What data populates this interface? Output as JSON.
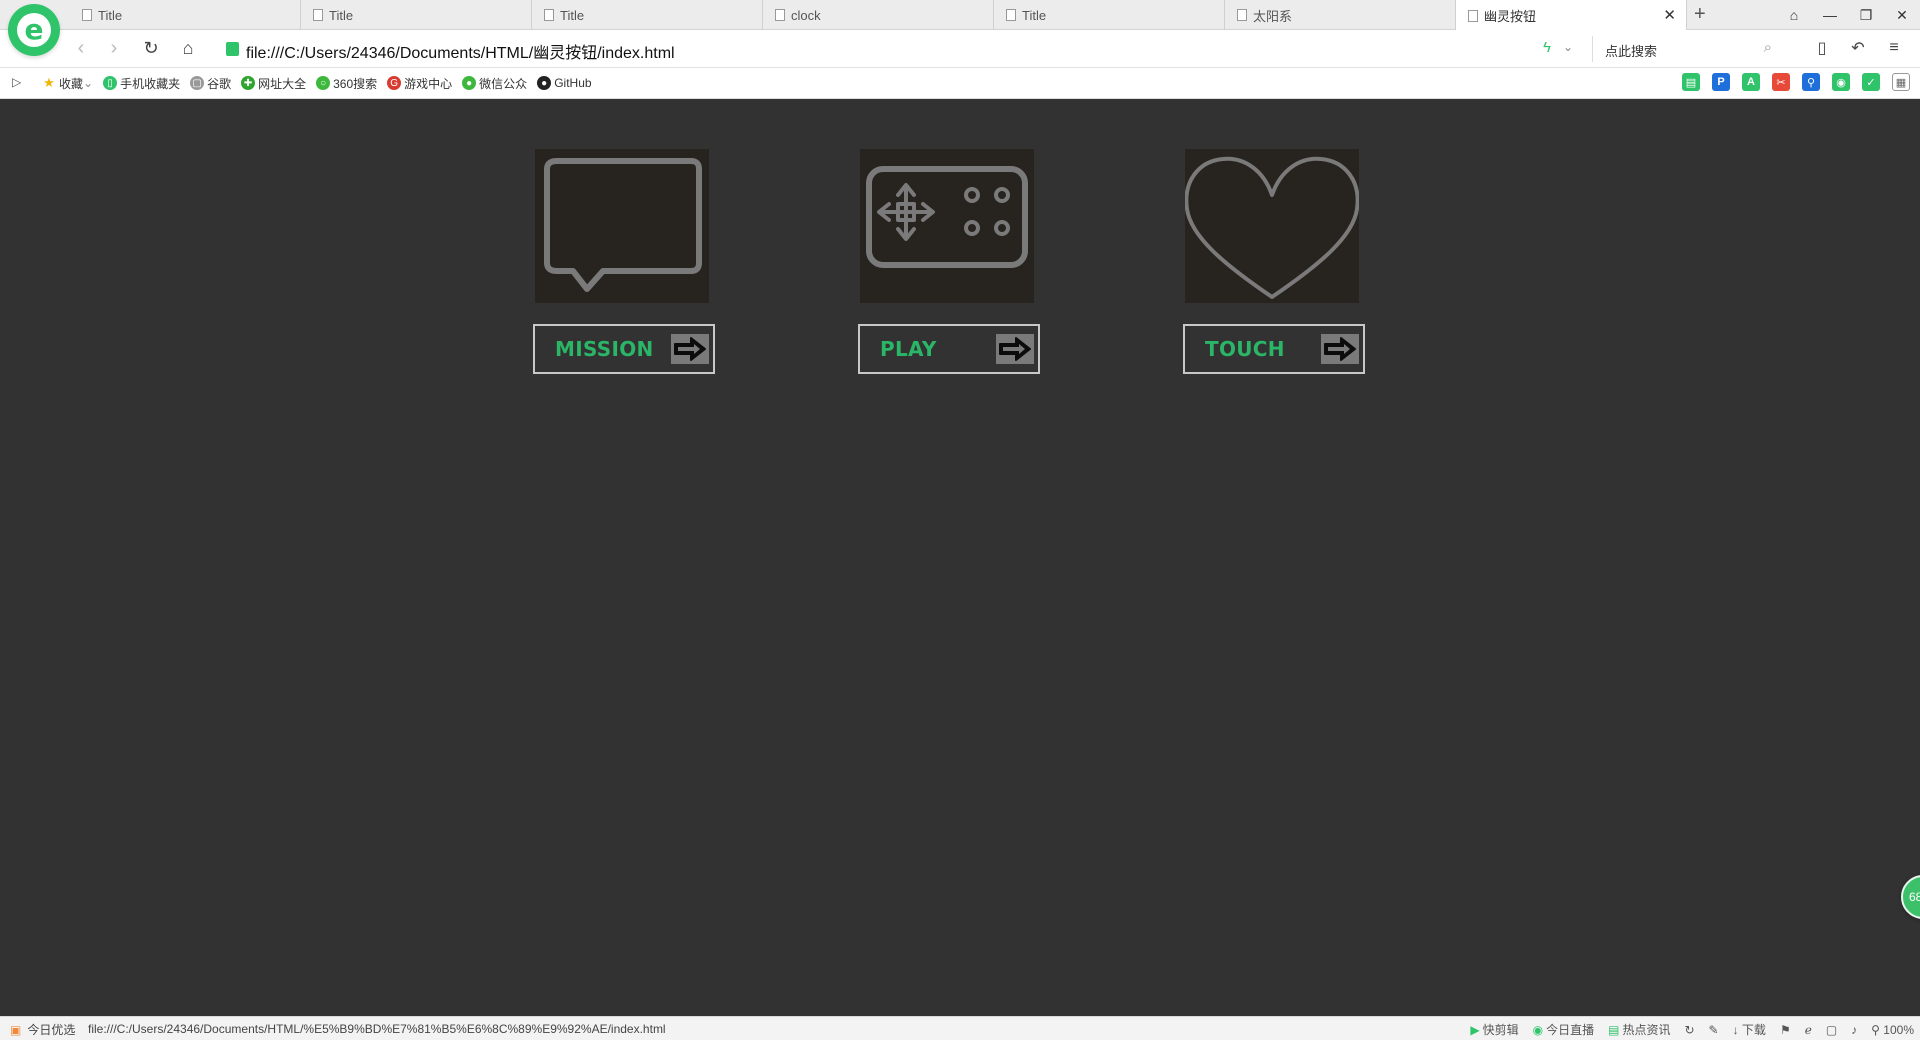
{
  "browser": {
    "tabs": [
      {
        "title": "Title",
        "active": false
      },
      {
        "title": "Title",
        "active": false
      },
      {
        "title": "Title",
        "active": false
      },
      {
        "title": "clock",
        "active": false
      },
      {
        "title": "Title",
        "active": false
      },
      {
        "title": "太阳系",
        "active": false
      },
      {
        "title": "幽灵按钮",
        "active": true
      }
    ],
    "address": "file:///C:/Users/24346/Documents/HTML/幽灵按钮/index.html",
    "search_placeholder": "点此搜索",
    "bookmarks": [
      {
        "label": "收藏",
        "icon": "star-icon",
        "color": "#f2b400"
      },
      {
        "label": "手机收藏夹",
        "icon": "phone-icon",
        "color": "#2fc36a"
      },
      {
        "label": "谷歌",
        "icon": "page-icon",
        "color": "#999999"
      },
      {
        "label": "网址大全",
        "icon": "compass-icon",
        "color": "#2fa52f"
      },
      {
        "label": "360搜索",
        "icon": "360-icon",
        "color": "#3db83d"
      },
      {
        "label": "游戏中心",
        "icon": "game-center-icon",
        "color": "#d83b2f"
      },
      {
        "label": "微信公众",
        "icon": "wechat-icon",
        "color": "#3db83d"
      },
      {
        "label": "GitHub",
        "icon": "github-icon",
        "color": "#222222"
      }
    ]
  },
  "page": {
    "background": "#323232",
    "accent": "#2bb566",
    "cards": [
      {
        "icon": "chat-bubble-icon",
        "button_label": "MISSION"
      },
      {
        "icon": "gamepad-icon",
        "button_label": "PLAY"
      },
      {
        "icon": "heart-icon",
        "button_label": "TOUCH"
      }
    ],
    "float_badge": "68"
  },
  "statusbar": {
    "left_label": "今日优选",
    "url": "file:///C:/Users/24346/Documents/HTML/%E5%B9%BD%E7%81%B5%E6%8C%89%E9%92%AE/index.html",
    "items": [
      "快剪辑",
      "今日直播",
      "热点资讯",
      "下载"
    ],
    "zoom": "100%"
  }
}
